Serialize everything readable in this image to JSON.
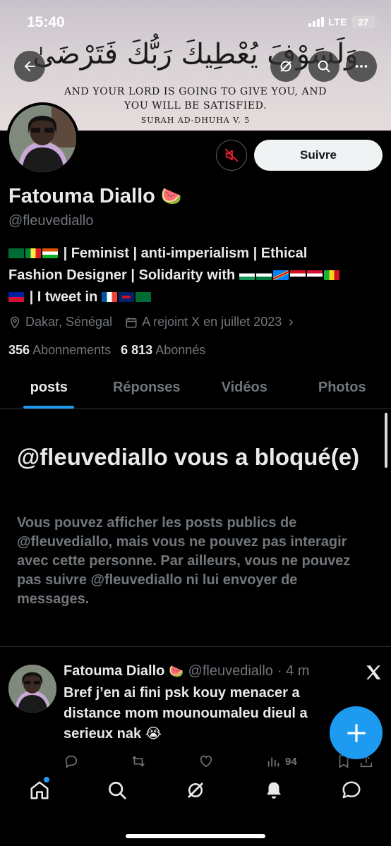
{
  "status_bar": {
    "time": "15:40",
    "network": "LTE",
    "battery": "27"
  },
  "banner": {
    "arabic_text": "وَلَسَوْفَ يُعْطِيكَ رَبُّكَ فَتَرْضَىٰ",
    "quote_line1": "AND YOUR LORD IS GOING TO GIVE YOU, AND",
    "quote_line2": "YOU WILL BE SATISFIED.",
    "quote_ref": "SURAH AD-DHUHA V. 5"
  },
  "profile": {
    "name": "Fatouma Diallo",
    "name_emoji": "🍉",
    "handle": "@fleuvediallo",
    "follow_label": "Suivre",
    "bio_line1_text": "| Feminist | anti-imperialism | Ethical",
    "bio_line2_text": "Fashion Designer | Solidarity with",
    "bio_line3_text": "| I tweet in",
    "location": "Dakar, Sénégal",
    "joined": "A rejoint X en juillet 2023",
    "following_count": "356",
    "following_label": "Abonnements",
    "followers_count": "6 813",
    "followers_label": "Abonnés"
  },
  "tabs": [
    {
      "label": "posts"
    },
    {
      "label": "Réponses"
    },
    {
      "label": "Vidéos"
    },
    {
      "label": "Photos"
    }
  ],
  "blocked": {
    "title": "@fleuvediallo vous a bloqué(e)",
    "message": "Vous pouvez afficher les posts publics de @fleuvediallo, mais vous ne pouvez pas interagir avec cette personne. Par ailleurs, vous ne pouvez pas suivre @fleuvediallo ni lui envoyer de messages."
  },
  "tweet": {
    "name": "Fatouma Diallo",
    "emoji": "🍉",
    "handle": "@fleuvediallo",
    "time": "· 4 m",
    "text": "Bref j’en ai fini psk kouy menacer a distance mom mounoumaleu dieul a serieux nak 😭",
    "views": "94"
  },
  "colors": {
    "accent": "#1d9bf0",
    "muted": "#71767b",
    "mute_icon": "#f4212e"
  },
  "icons": [
    "back-arrow-icon",
    "grok-icon",
    "search-icon",
    "more-icon",
    "mute-icon",
    "location-icon",
    "calendar-icon",
    "chevron-right-icon",
    "x-logo-icon",
    "reply-icon",
    "retweet-icon",
    "like-icon",
    "views-icon",
    "bookmark-icon",
    "share-icon",
    "compose-icon",
    "home-icon",
    "explore-icon",
    "grok-nav-icon",
    "notifications-icon",
    "messages-icon"
  ]
}
